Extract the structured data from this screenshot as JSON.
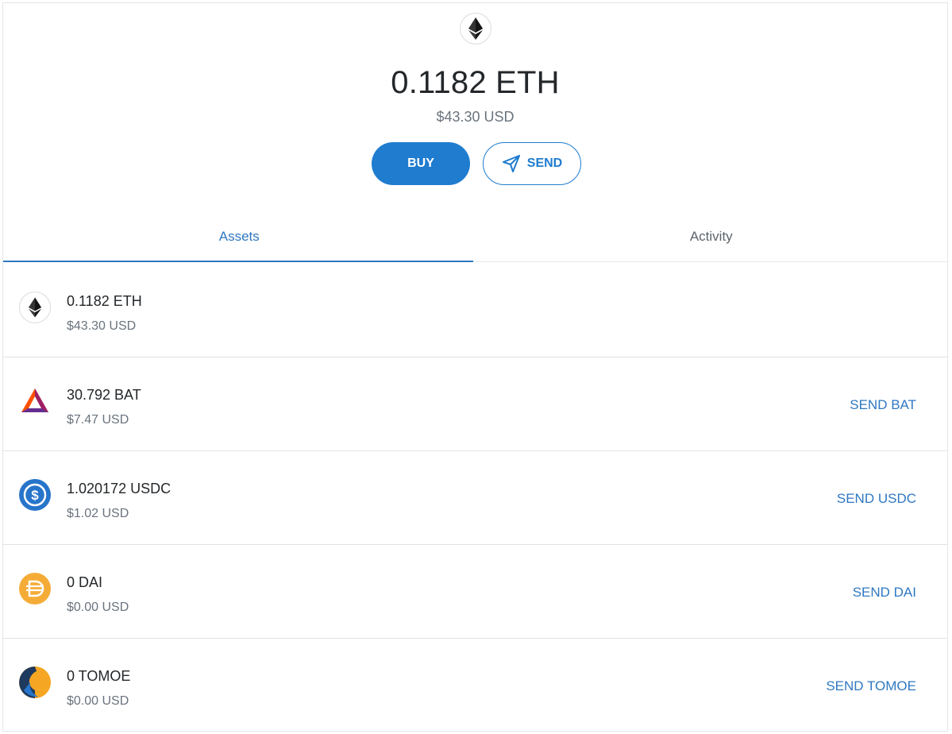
{
  "hero": {
    "balance": "0.1182 ETH",
    "fiat": "$43.30 USD",
    "buy_label": "BUY",
    "send_label": "SEND",
    "icon": "ethereum-icon"
  },
  "tabs": [
    {
      "label": "Assets",
      "active": true
    },
    {
      "label": "Activity",
      "active": false
    }
  ],
  "colors": {
    "accent": "#1f7ccf",
    "link": "#2f78c2",
    "text": "#24272a",
    "muted": "#6a737d"
  },
  "assets": [
    {
      "amount": "0.1182 ETH",
      "fiat": "$43.30 USD",
      "send_label": "",
      "icon": "ethereum-icon"
    },
    {
      "amount": "30.792 BAT",
      "fiat": "$7.47 USD",
      "send_label": "SEND BAT",
      "icon": "bat-icon"
    },
    {
      "amount": "1.020172 USDC",
      "fiat": "$1.02 USD",
      "send_label": "SEND USDC",
      "icon": "usdc-icon"
    },
    {
      "amount": "0 DAI",
      "fiat": "$0.00 USD",
      "send_label": "SEND DAI",
      "icon": "dai-icon"
    },
    {
      "amount": "0 TOMOE",
      "fiat": "$0.00 USD",
      "send_label": "SEND TOMOE",
      "icon": "tomoe-icon"
    }
  ]
}
